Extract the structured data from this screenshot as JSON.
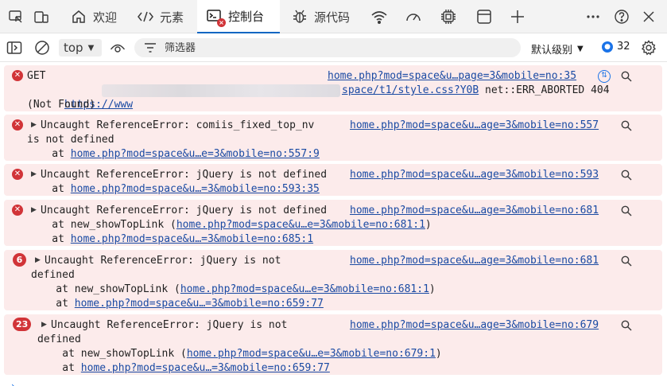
{
  "tabs": {
    "welcome": "欢迎",
    "elements": "元素",
    "console": "控制台",
    "sources": "源代码"
  },
  "toolbar": {
    "context": "top",
    "filter_placeholder": "筛选器",
    "level": "默认级别",
    "issues_count": "32"
  },
  "messages": [
    {
      "type": "error",
      "lines": [
        "GET",
        "",
        "(Not Found)"
      ],
      "url_prefix": "https://www",
      "url_suffix": "space/t1/style.css?Y0B",
      "status": " net::ERR_ABORTED 404",
      "source": "home.php?mod=space&u…page=3&mobile=no:35"
    },
    {
      "type": "error",
      "lines": [
        "Uncaught ReferenceError: comiis_fixed_top_nv",
        "is not defined",
        "    at "
      ],
      "stack": [
        "home.php?mod=space&u…e=3&mobile=no:557:9"
      ],
      "source": "home.php?mod=space&u…age=3&mobile=no:557"
    },
    {
      "type": "error",
      "lines": [
        "Uncaught ReferenceError: jQuery is not defined",
        "    at "
      ],
      "stack": [
        "home.php?mod=space&u…=3&mobile=no:593:35"
      ],
      "source": "home.php?mod=space&u…age=3&mobile=no:593"
    },
    {
      "type": "error",
      "lines": [
        "Uncaught ReferenceError: jQuery is not defined",
        "    at new_showTopLink (",
        "    at "
      ],
      "stack": [
        "home.php?mod=space&u…e=3&mobile=no:681:1",
        "home.php?mod=space&u…=3&mobile=no:685:1"
      ],
      "close": ")",
      "source": "home.php?mod=space&u…age=3&mobile=no:681"
    },
    {
      "type": "error",
      "count": "6",
      "lines": [
        "Uncaught ReferenceError: jQuery is not",
        "defined",
        "    at new_showTopLink (",
        "    at "
      ],
      "stack": [
        "home.php?mod=space&u…e=3&mobile=no:681:1",
        "home.php?mod=space&u…=3&mobile=no:659:77"
      ],
      "close": ")",
      "source": "home.php?mod=space&u…age=3&mobile=no:681"
    },
    {
      "type": "error",
      "count": "23",
      "lines": [
        "Uncaught ReferenceError: jQuery is not",
        "defined",
        "    at new_showTopLink (",
        "    at "
      ],
      "stack": [
        "home.php?mod=space&u…e=3&mobile=no:679:1",
        "home.php?mod=space&u…=3&mobile=no:659:77"
      ],
      "close": ")",
      "source": "home.php?mod=space&u…age=3&mobile=no:679"
    }
  ]
}
